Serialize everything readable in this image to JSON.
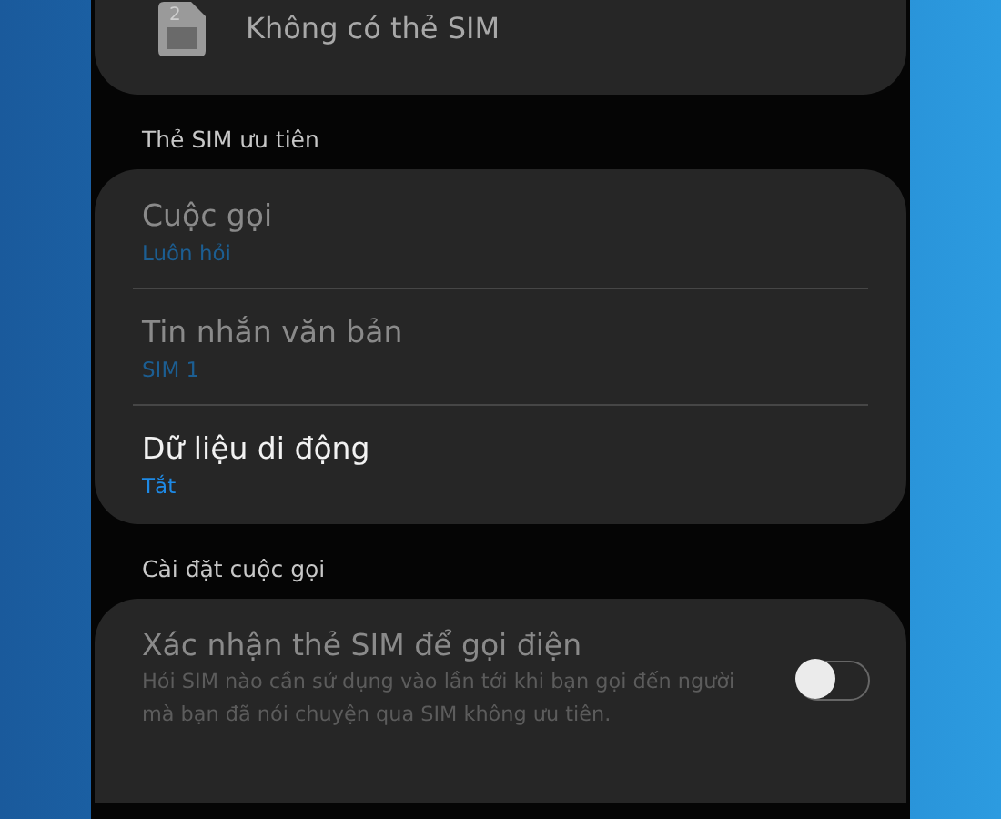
{
  "sim_status": {
    "slot": "2",
    "label": "Không có thẻ SIM"
  },
  "preferred_sim": {
    "header": "Thẻ SIM ưu tiên",
    "items": [
      {
        "title": "Cuộc gọi",
        "value": "Luôn hỏi",
        "disabled": true
      },
      {
        "title": "Tin nhắn văn bản",
        "value": "SIM 1",
        "disabled": true
      },
      {
        "title": "Dữ liệu di động",
        "value": "Tắt",
        "disabled": false
      }
    ]
  },
  "call_settings": {
    "header": "Cài đặt cuộc gọi",
    "items": [
      {
        "title": "Xác nhận thẻ SIM để gọi điện",
        "description": "Hỏi SIM nào cần sử dụng vào lần tới khi bạn gọi đến người mà bạn đã nói chuyện qua SIM không ưu tiên.",
        "disabled": true,
        "on": false
      }
    ]
  }
}
